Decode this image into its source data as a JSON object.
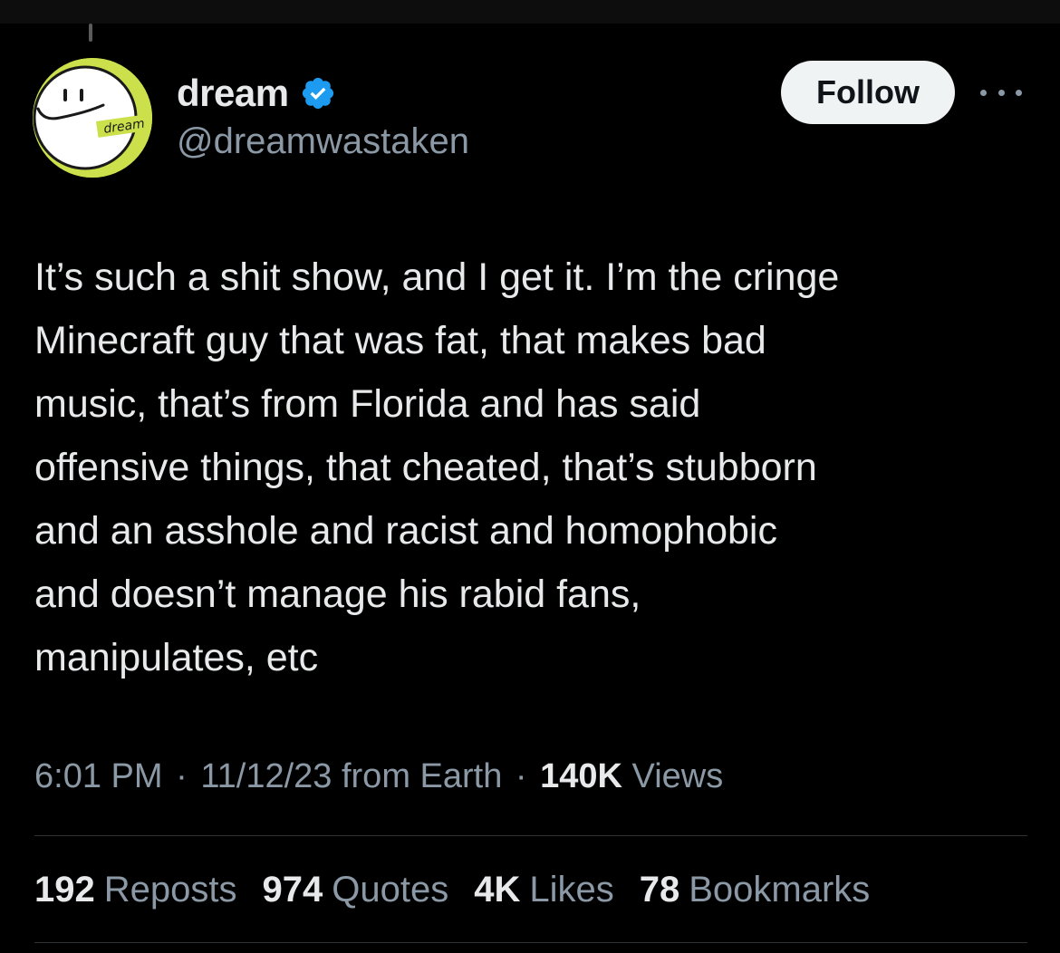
{
  "colors": {
    "background": "#000000",
    "primary_text": "#e7e9ea",
    "secondary_text": "#8b98a5",
    "verified_blue": "#1d9bf0",
    "follow_button_bg": "#eff3f4",
    "avatar_bg": "#cbe04a",
    "divider": "#2f3336"
  },
  "author": {
    "avatar_text": "dream",
    "display_name": "dream",
    "verified": true,
    "handle": "@dreamwastaken"
  },
  "actions": {
    "follow_label": "Follow",
    "more_icon": "more-horizontal-icon"
  },
  "tweet": {
    "text": "It’s such a shit show, and I get it. I’m the cringe\nMinecraft guy that was fat, that makes bad\nmusic, that’s from Florida and has said\noffensive things, that cheated, that’s stubborn\nand an asshole and racist and homophobic\nand doesn’t manage his rabid fans,\nmanipulates, etc"
  },
  "meta": {
    "time": "6:01 PM",
    "separator": "·",
    "date": "11/12/23 from Earth",
    "views_count": "140K",
    "views_label": "Views"
  },
  "stats": [
    {
      "count": "192",
      "label": "Reposts"
    },
    {
      "count": "974",
      "label": "Quotes"
    },
    {
      "count": "4K",
      "label": "Likes"
    },
    {
      "count": "78",
      "label": "Bookmarks"
    }
  ]
}
